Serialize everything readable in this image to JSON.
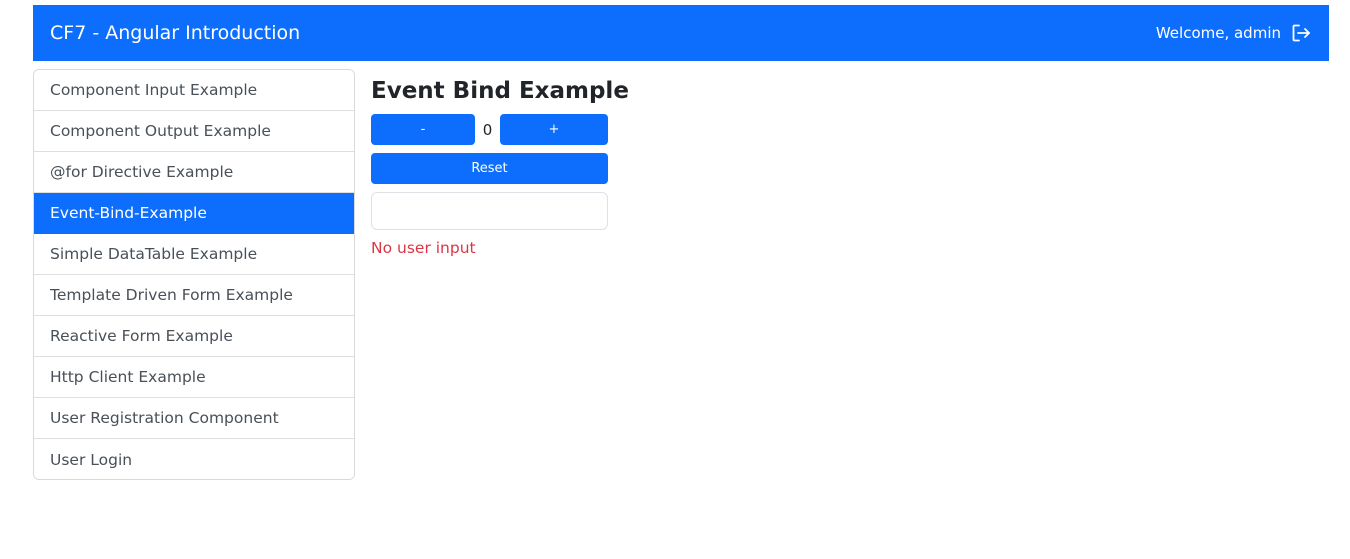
{
  "header": {
    "brand": "CF7 - Angular Introduction",
    "welcome": "Welcome, admin",
    "logout_icon": "box-arrow-right-icon"
  },
  "sidebar": {
    "active_index": 3,
    "items": [
      {
        "label": "Component Input Example"
      },
      {
        "label": "Component Output Example"
      },
      {
        "label": "@for Directive Example"
      },
      {
        "label": "Event-Bind-Example"
      },
      {
        "label": "Simple DataTable Example"
      },
      {
        "label": "Template Driven Form Example"
      },
      {
        "label": "Reactive Form Example"
      },
      {
        "label": "Http Client Example"
      },
      {
        "label": "User Registration Component"
      },
      {
        "label": "User Login"
      }
    ]
  },
  "main": {
    "title": "Event Bind Example",
    "decrement_label": "-",
    "counter_value": "0",
    "increment_label": "+",
    "reset_label": "Reset",
    "input_value": "",
    "input_placeholder": "",
    "status_text": "No user input"
  },
  "colors": {
    "primary": "#0d6efd",
    "danger": "#dc3545"
  }
}
